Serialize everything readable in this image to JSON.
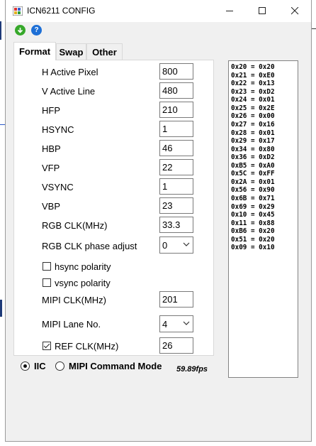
{
  "window": {
    "title": "ICN6211 CONFIG"
  },
  "toolbar": {
    "icons": [
      "download-icon",
      "help-icon"
    ]
  },
  "tabs": [
    "Format",
    "Swap",
    "Other"
  ],
  "fields": [
    {
      "label": "H Active Pixel",
      "value": "800"
    },
    {
      "label": "V Active Line",
      "value": "480"
    },
    {
      "label": "HFP",
      "value": "210"
    },
    {
      "label": "HSYNC",
      "value": "1"
    },
    {
      "label": "HBP",
      "value": "46"
    },
    {
      "label": "VFP",
      "value": "22"
    },
    {
      "label": "VSYNC",
      "value": "1"
    },
    {
      "label": "VBP",
      "value": "23"
    },
    {
      "label": "RGB CLK(MHz)",
      "value": "33.3"
    }
  ],
  "phase": {
    "label": "RGB CLK phase adjust",
    "value": "0"
  },
  "hsync_polarity": {
    "label": "hsync polarity",
    "checked": false
  },
  "vsync_polarity": {
    "label": "vsync polarity",
    "checked": false
  },
  "mipi_clk": {
    "label": "MIPI CLK(MHz)",
    "value": "201"
  },
  "mipi_lane": {
    "label": "MIPI Lane No.",
    "value": "4"
  },
  "ref_clk": {
    "label": "REF CLK(MHz)",
    "value": "26",
    "checked": true
  },
  "mode": {
    "iic_label": "IIC",
    "mipi_label": "MIPI Command Mode",
    "selected": "IIC"
  },
  "fps": "59.89fps",
  "registers": [
    "0x20 = 0x20",
    "0x21 = 0xE0",
    "0x22 = 0x13",
    "0x23 = 0xD2",
    "0x24 = 0x01",
    "0x25 = 0x2E",
    "0x26 = 0x00",
    "0x27 = 0x16",
    "0x28 = 0x01",
    "0x29 = 0x17",
    "0x34 = 0x80",
    "0x36 = 0xD2",
    "0xB5 = 0xA0",
    "0x5C = 0xFF",
    "0x2A = 0x01",
    "0x56 = 0x90",
    "0x6B = 0x71",
    "0x69 = 0x29",
    "0x10 = 0x45",
    "0x11 = 0x88",
    "0xB6 = 0x20",
    "0x51 = 0x20",
    "0x09 = 0x10"
  ],
  "colors": {
    "title_bg": "#ffffff",
    "window_bg": "#f0f0f0",
    "download_icon": "#36a82a",
    "help_icon": "#1d6fd6"
  }
}
